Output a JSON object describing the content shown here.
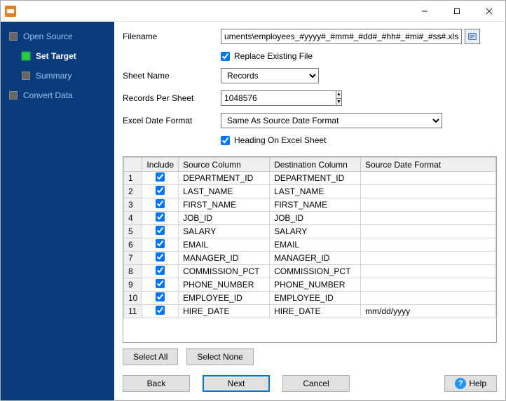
{
  "sidebar": {
    "items": [
      {
        "label": "Open Source",
        "active": false,
        "green": false
      },
      {
        "label": "Set Target",
        "active": true,
        "green": true
      },
      {
        "label": "Summary",
        "active": false,
        "green": false
      },
      {
        "label": "Convert Data",
        "active": false,
        "green": false
      }
    ]
  },
  "form": {
    "filename_label": "Filename",
    "filename_value": "uments\\employees_#yyyy#_#mm#_#dd#_#hh#_#mi#_#ss#.xlsx",
    "replace_existing_label": "Replace Existing File",
    "replace_existing_checked": true,
    "sheet_name_label": "Sheet Name",
    "sheet_name_value": "Records",
    "records_per_sheet_label": "Records Per Sheet",
    "records_per_sheet_value": "1048576",
    "excel_date_format_label": "Excel Date Format",
    "excel_date_format_value": "Same As Source Date Format",
    "heading_on_sheet_label": "Heading On Excel Sheet",
    "heading_on_sheet_checked": true
  },
  "table": {
    "headers": {
      "include": "Include",
      "source": "Source Column",
      "dest": "Destination Column",
      "date_fmt": "Source Date Format"
    },
    "rows": [
      {
        "n": "1",
        "inc": true,
        "src": "DEPARTMENT_ID",
        "dst": "DEPARTMENT_ID",
        "fmt": ""
      },
      {
        "n": "2",
        "inc": true,
        "src": "LAST_NAME",
        "dst": "LAST_NAME",
        "fmt": ""
      },
      {
        "n": "3",
        "inc": true,
        "src": "FIRST_NAME",
        "dst": "FIRST_NAME",
        "fmt": ""
      },
      {
        "n": "4",
        "inc": true,
        "src": "JOB_ID",
        "dst": "JOB_ID",
        "fmt": ""
      },
      {
        "n": "5",
        "inc": true,
        "src": "SALARY",
        "dst": "SALARY",
        "fmt": ""
      },
      {
        "n": "6",
        "inc": true,
        "src": "EMAIL",
        "dst": "EMAIL",
        "fmt": ""
      },
      {
        "n": "7",
        "inc": true,
        "src": "MANAGER_ID",
        "dst": "MANAGER_ID",
        "fmt": ""
      },
      {
        "n": "8",
        "inc": true,
        "src": "COMMISSION_PCT",
        "dst": "COMMISSION_PCT",
        "fmt": ""
      },
      {
        "n": "9",
        "inc": true,
        "src": "PHONE_NUMBER",
        "dst": "PHONE_NUMBER",
        "fmt": ""
      },
      {
        "n": "10",
        "inc": true,
        "src": "EMPLOYEE_ID",
        "dst": "EMPLOYEE_ID",
        "fmt": ""
      },
      {
        "n": "11",
        "inc": true,
        "src": "HIRE_DATE",
        "dst": "HIRE_DATE",
        "fmt": "mm/dd/yyyy"
      }
    ]
  },
  "buttons": {
    "select_all": "Select All",
    "select_none": "Select None",
    "back": "Back",
    "next": "Next",
    "cancel": "Cancel",
    "help": "Help"
  }
}
